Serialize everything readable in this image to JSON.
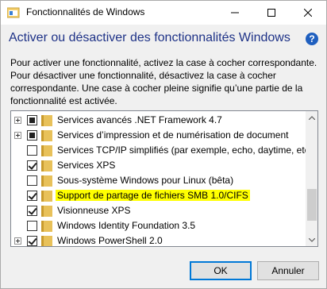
{
  "window": {
    "title": "Fonctionnalités de Windows"
  },
  "header": {
    "heading": "Activer ou désactiver des fonctionnalités Windows",
    "help_icon": "help-icon"
  },
  "description": "Pour activer une fonctionnalité, activez la case à cocher correspondante. Pour désactiver une fonctionnalité, désactivez la case à cocher correspondante. Une case à cocher pleine signifie qu’une partie de la fonctionnalité est activée.",
  "features": [
    {
      "label": "Services avancés .NET Framework 4.7",
      "state": "partial",
      "expandable": true
    },
    {
      "label": "Services d’impression et de numérisation de document",
      "state": "partial",
      "expandable": true
    },
    {
      "label": "Services TCP/IP simplifiés (par exemple, echo, daytime, etc.)",
      "state": "unchecked",
      "expandable": false
    },
    {
      "label": "Services XPS",
      "state": "checked",
      "expandable": false
    },
    {
      "label": "Sous-système Windows pour Linux (bêta)",
      "state": "unchecked",
      "expandable": false
    },
    {
      "label": "Support de partage de fichiers SMB 1.0/CIFS",
      "state": "checked",
      "expandable": false,
      "highlighted": true
    },
    {
      "label": "Visionneuse XPS",
      "state": "checked",
      "expandable": false
    },
    {
      "label": "Windows Identity Foundation 3.5",
      "state": "unchecked",
      "expandable": false
    },
    {
      "label": "Windows PowerShell 2.0",
      "state": "checked",
      "expandable": true
    }
  ],
  "buttons": {
    "ok": "OK",
    "cancel": "Annuler"
  },
  "colors": {
    "heading": "#1e3287",
    "highlight": "#ffff00",
    "folder": "#e8c15a",
    "ok_border": "#0078d7"
  }
}
